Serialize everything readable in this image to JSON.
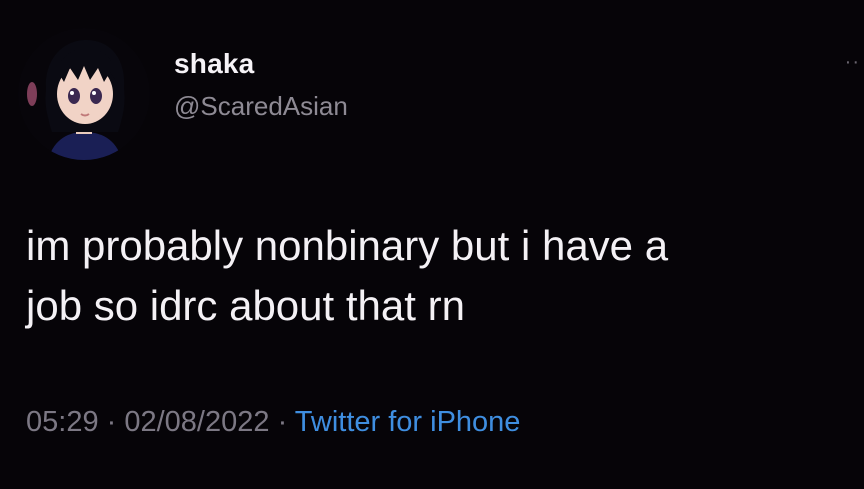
{
  "tweet": {
    "display_name": "shaka",
    "handle": "@ScaredAsian",
    "text": "im probably nonbinary but i have a\njob so idrc about that rn",
    "time": "05:29",
    "separator_1": " · ",
    "date": "02/08/2022",
    "separator_2": " · ",
    "source": "Twitter for iPhone",
    "avatar_icon": "anime-girl-avatar",
    "more_icon": "more-options-icon"
  },
  "colors": {
    "background": "#060408",
    "text": "#f4f1f5",
    "secondary": "#8e8a94",
    "link": "#3f8ee0"
  }
}
